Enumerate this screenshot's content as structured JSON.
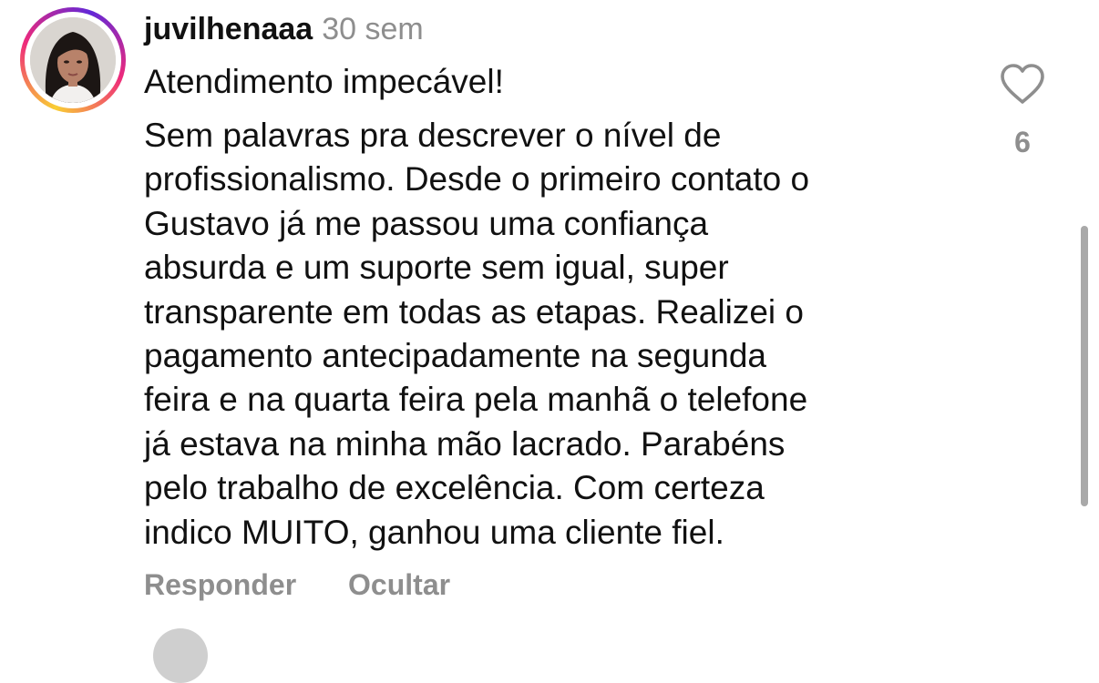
{
  "comment": {
    "username": "juvilhenaaa",
    "time": "30 sem",
    "title": "Atendimento impecável!",
    "body_lines": [
      "Sem palavras pra descrever o nível de",
      "profissionalismo. Desde o primeiro contato o",
      "Gustavo já me passou uma confiança",
      "absurda e um suporte sem igual, super",
      "transparente em todas as etapas. Realizei o",
      "pagamento antecipadamente na segunda",
      "feira  e na quarta feira pela manhã o telefone",
      "já estava na minha mão lacrado. Parabéns",
      "pelo trabalho de excelência. Com certeza",
      "indico MUITO, ganhou uma cliente fiel."
    ],
    "actions": {
      "reply": "Responder",
      "hide": "Ocultar"
    },
    "like": {
      "icon": "heart-outline-icon",
      "count": "6"
    }
  },
  "colors": {
    "text": "#111111",
    "muted": "#8e8e8e",
    "story_ring": [
      "#f9ce34",
      "#ee2a7b",
      "#6228d7"
    ]
  }
}
